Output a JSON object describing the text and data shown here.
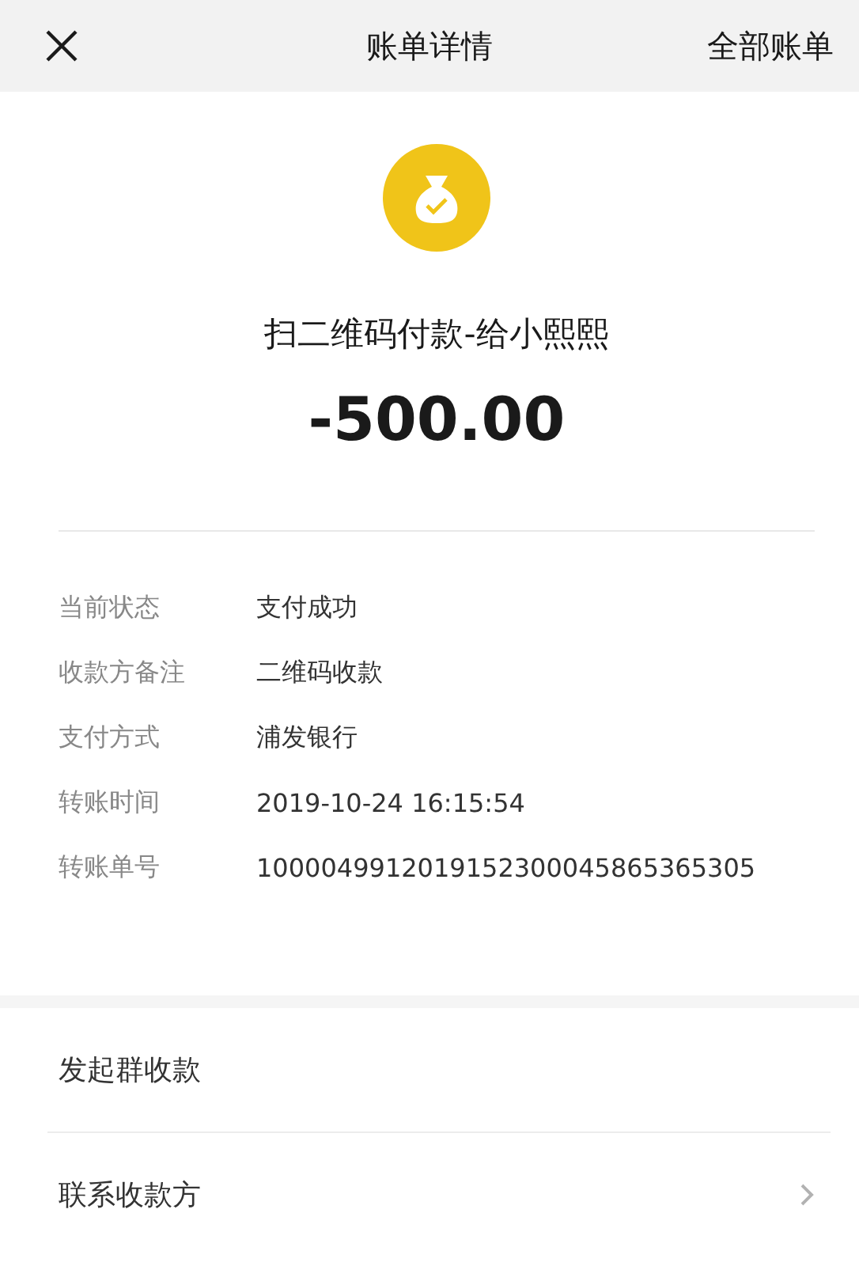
{
  "header": {
    "title": "账单详情",
    "right_link": "全部账单"
  },
  "summary": {
    "title": "扫二维码付款-给小熙熙",
    "amount": "-500.00"
  },
  "details": [
    {
      "label": "当前状态",
      "value": "支付成功"
    },
    {
      "label": "收款方备注",
      "value": "二维码收款"
    },
    {
      "label": "支付方式",
      "value": "浦发银行"
    },
    {
      "label": "转账时间",
      "value": "2019-10-24 16:15:54"
    },
    {
      "label": "转账单号",
      "value": "1000049912019152300045865365305"
    }
  ],
  "actions": [
    {
      "label": "发起群收款",
      "kind": "plain"
    },
    {
      "label": "联系收款方",
      "kind": "link"
    }
  ]
}
